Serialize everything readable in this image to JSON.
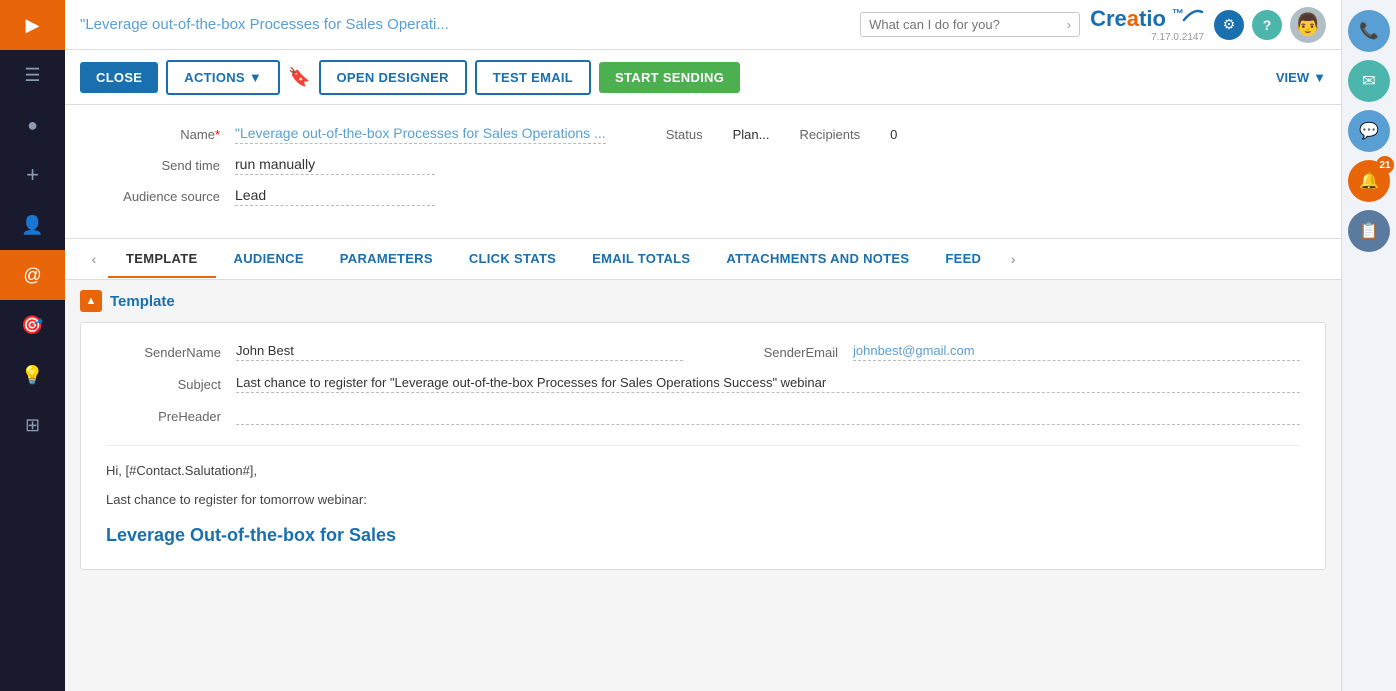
{
  "sidebar": {
    "items": [
      {
        "id": "collapse",
        "icon": "▶",
        "active": false
      },
      {
        "id": "menu",
        "icon": "☰",
        "active": false
      },
      {
        "id": "play",
        "icon": "▶",
        "active": false
      },
      {
        "id": "plus",
        "icon": "+",
        "active": false
      },
      {
        "id": "user",
        "icon": "👤",
        "active": false
      },
      {
        "id": "email",
        "icon": "@",
        "active": true
      },
      {
        "id": "target",
        "icon": "🎯",
        "active": false
      },
      {
        "id": "bulb",
        "icon": "💡",
        "active": false
      },
      {
        "id": "grid",
        "icon": "⊞",
        "active": false
      }
    ]
  },
  "header": {
    "title": "\"Leverage out-of-the-box Processes for Sales Operati...",
    "search_placeholder": "What can I do for you?",
    "logo_text": "Creatio",
    "version": "7.17.0.2147"
  },
  "toolbar": {
    "close_label": "CLOSE",
    "actions_label": "ACTIONS",
    "open_designer_label": "OPEN DESIGNER",
    "test_email_label": "TEST EMAIL",
    "start_sending_label": "START SENDING",
    "view_label": "VIEW"
  },
  "form": {
    "name_label": "Name",
    "name_value": "\"Leverage out-of-the-box Processes for Sales Operations ...",
    "status_label": "Status",
    "status_value": "Plan...",
    "recipients_label": "Recipients",
    "recipients_value": "0",
    "send_time_label": "Send time",
    "send_time_value": "run manually",
    "audience_source_label": "Audience source",
    "audience_source_value": "Lead"
  },
  "tabs": {
    "items": [
      {
        "id": "template",
        "label": "TEMPLATE",
        "active": true
      },
      {
        "id": "audience",
        "label": "AUDIENCE",
        "active": false
      },
      {
        "id": "parameters",
        "label": "PARAMETERS",
        "active": false
      },
      {
        "id": "click_stats",
        "label": "CLICK STATS",
        "active": false
      },
      {
        "id": "email_totals",
        "label": "EMAIL TOTALS",
        "active": false
      },
      {
        "id": "attachments_notes",
        "label": "ATTACHMENTS AND NOTES",
        "active": false
      },
      {
        "id": "feed",
        "label": "FEED",
        "active": false
      }
    ]
  },
  "template_section": {
    "title": "Template",
    "sender_name_label": "SenderName",
    "sender_name_value": "John Best",
    "sender_email_label": "SenderEmail",
    "sender_email_value": "johnbest@gmail.com",
    "subject_label": "Subject",
    "subject_value": "Last chance to register for \"Leverage out-of-the-box Processes for Sales Operations Success\" webinar",
    "preheader_label": "PreHeader",
    "preheader_value": ""
  },
  "email_content": {
    "greeting": "Hi, [#Contact.Salutation#],",
    "line1": "Last chance to register for tomorrow webinar:",
    "heading": "Leverage Out-of-the-box for Sales"
  },
  "right_sidebar": {
    "phone_icon": "📞",
    "email_icon": "✉",
    "chat_icon": "💬",
    "notification_icon": "🔔",
    "notification_count": "21",
    "clipboard_icon": "📋"
  }
}
